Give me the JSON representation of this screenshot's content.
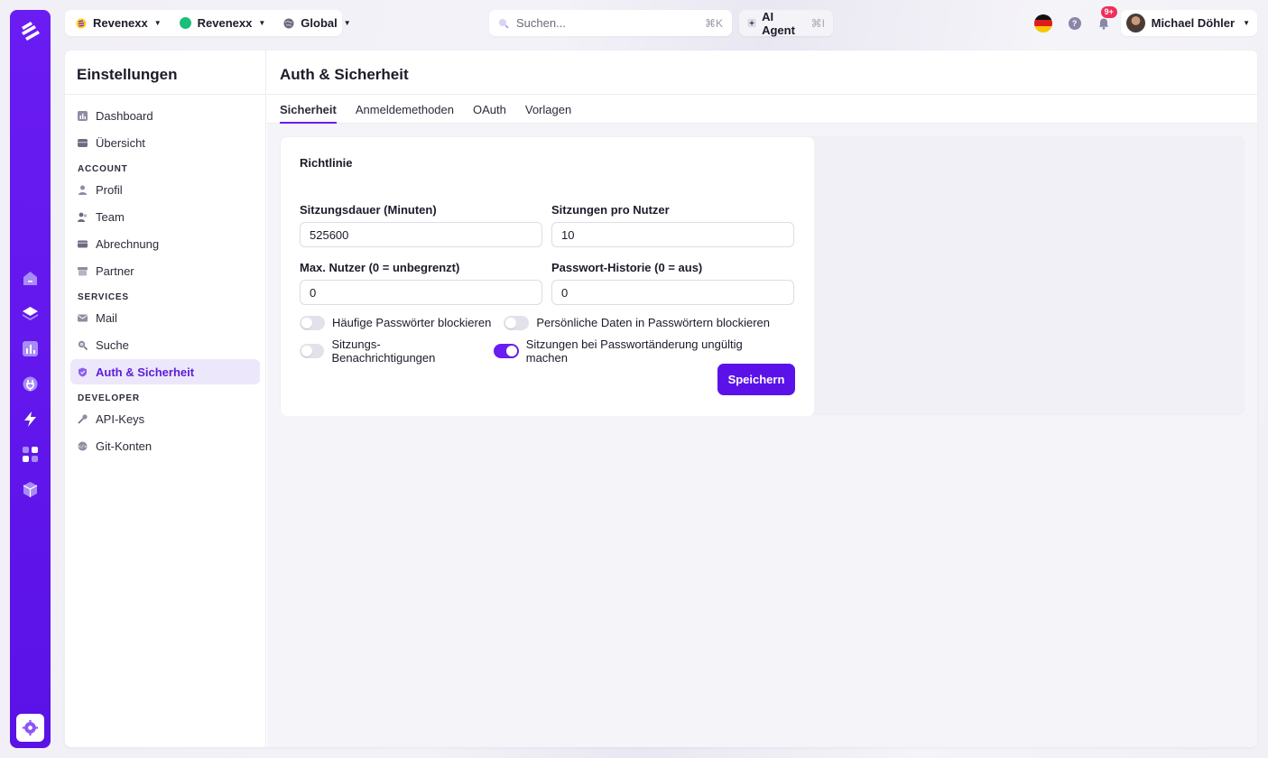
{
  "topbar": {
    "workspace": "Revenexx",
    "project": "Revenexx",
    "region": "Global",
    "search_placeholder": "Suchen...",
    "search_shortcut": "⌘K",
    "ai_label": "AI Agent",
    "ai_shortcut": "⌘I",
    "notifications_badge": "9+",
    "user_name": "Michael Döhler",
    "project_dot_color": "#1bbf7a"
  },
  "sidebar": {
    "title": "Einstellungen",
    "items": [
      {
        "label": "Dashboard",
        "icon": "dashboard-icon"
      },
      {
        "label": "Übersicht",
        "icon": "overview-icon"
      }
    ],
    "account_heading": "ACCOUNT",
    "account": [
      {
        "label": "Profil",
        "icon": "user-icon"
      },
      {
        "label": "Team",
        "icon": "team-icon"
      },
      {
        "label": "Abrechnung",
        "icon": "billing-icon"
      },
      {
        "label": "Partner",
        "icon": "partner-icon"
      }
    ],
    "services_heading": "SERVICES",
    "services": [
      {
        "label": "Mail",
        "icon": "mail-icon"
      },
      {
        "label": "Suche",
        "icon": "search-icon"
      },
      {
        "label": "Auth & Sicherheit",
        "icon": "shield-icon",
        "active": true
      }
    ],
    "developer_heading": "DEVELOPER",
    "developer": [
      {
        "label": "API-Keys",
        "icon": "key-icon"
      },
      {
        "label": "Git-Konten",
        "icon": "git-icon"
      }
    ]
  },
  "page": {
    "title": "Auth & Sicherheit",
    "tabs": [
      {
        "label": "Sicherheit",
        "active": true
      },
      {
        "label": "Anmeldemethoden"
      },
      {
        "label": "OAuth"
      },
      {
        "label": "Vorlagen"
      }
    ]
  },
  "policy": {
    "heading": "Richtlinie",
    "session_duration_label": "Sitzungsdauer (Minuten)",
    "session_duration_value": "525600",
    "sessions_per_user_label": "Sitzungen pro Nutzer",
    "sessions_per_user_value": "10",
    "max_users_label": "Max. Nutzer (0 = unbegrenzt)",
    "max_users_value": "0",
    "password_history_label": "Passwort-Historie (0 = aus)",
    "password_history_value": "0",
    "toggles": {
      "common_passwords": {
        "label": "Häufige Passwörter blockieren",
        "on": false
      },
      "personal_data": {
        "label": "Persönliche Daten in Passwörtern blockieren",
        "on": false
      },
      "session_notifications": {
        "label": "Sitzungs-Benachrichtigungen",
        "on": false
      },
      "invalidate_sessions": {
        "label": "Sitzungen bei Passwortänderung ungültig machen",
        "on": true
      }
    },
    "save_label": "Speichern"
  },
  "colors": {
    "accent": "#6a1cf2",
    "badge": "#ef2f5a"
  }
}
